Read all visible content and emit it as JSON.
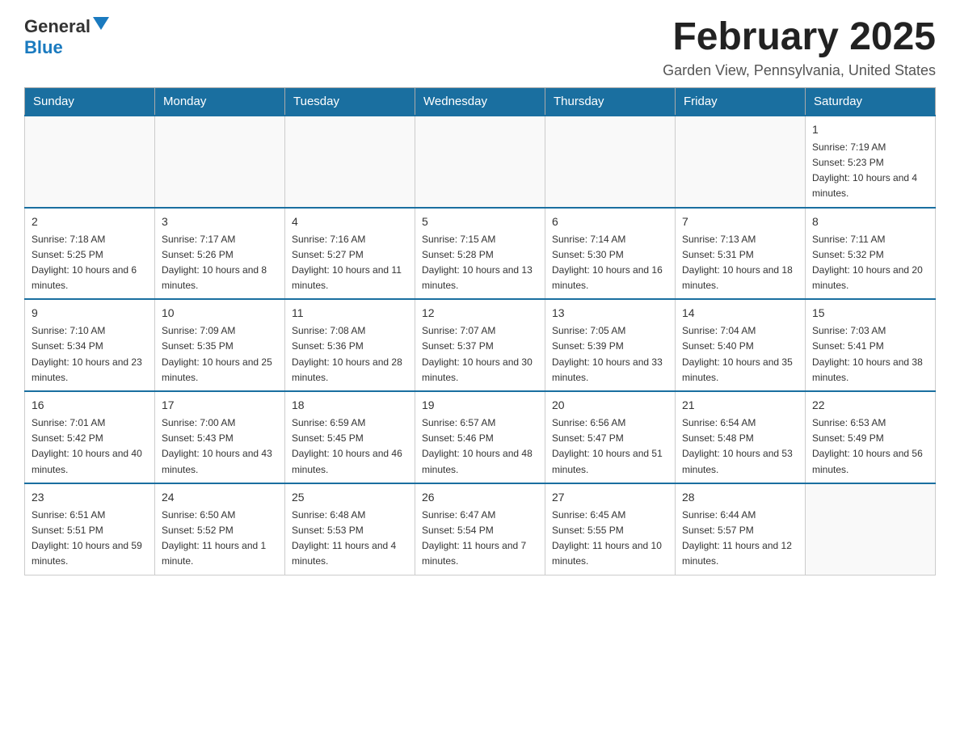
{
  "header": {
    "logo_general": "General",
    "logo_blue": "Blue",
    "month_title": "February 2025",
    "location": "Garden View, Pennsylvania, United States"
  },
  "days_of_week": [
    "Sunday",
    "Monday",
    "Tuesday",
    "Wednesday",
    "Thursday",
    "Friday",
    "Saturday"
  ],
  "weeks": [
    [
      {
        "day": "",
        "sunrise": "",
        "sunset": "",
        "daylight": ""
      },
      {
        "day": "",
        "sunrise": "",
        "sunset": "",
        "daylight": ""
      },
      {
        "day": "",
        "sunrise": "",
        "sunset": "",
        "daylight": ""
      },
      {
        "day": "",
        "sunrise": "",
        "sunset": "",
        "daylight": ""
      },
      {
        "day": "",
        "sunrise": "",
        "sunset": "",
        "daylight": ""
      },
      {
        "day": "",
        "sunrise": "",
        "sunset": "",
        "daylight": ""
      },
      {
        "day": "1",
        "sunrise": "Sunrise: 7:19 AM",
        "sunset": "Sunset: 5:23 PM",
        "daylight": "Daylight: 10 hours and 4 minutes."
      }
    ],
    [
      {
        "day": "2",
        "sunrise": "Sunrise: 7:18 AM",
        "sunset": "Sunset: 5:25 PM",
        "daylight": "Daylight: 10 hours and 6 minutes."
      },
      {
        "day": "3",
        "sunrise": "Sunrise: 7:17 AM",
        "sunset": "Sunset: 5:26 PM",
        "daylight": "Daylight: 10 hours and 8 minutes."
      },
      {
        "day": "4",
        "sunrise": "Sunrise: 7:16 AM",
        "sunset": "Sunset: 5:27 PM",
        "daylight": "Daylight: 10 hours and 11 minutes."
      },
      {
        "day": "5",
        "sunrise": "Sunrise: 7:15 AM",
        "sunset": "Sunset: 5:28 PM",
        "daylight": "Daylight: 10 hours and 13 minutes."
      },
      {
        "day": "6",
        "sunrise": "Sunrise: 7:14 AM",
        "sunset": "Sunset: 5:30 PM",
        "daylight": "Daylight: 10 hours and 16 minutes."
      },
      {
        "day": "7",
        "sunrise": "Sunrise: 7:13 AM",
        "sunset": "Sunset: 5:31 PM",
        "daylight": "Daylight: 10 hours and 18 minutes."
      },
      {
        "day": "8",
        "sunrise": "Sunrise: 7:11 AM",
        "sunset": "Sunset: 5:32 PM",
        "daylight": "Daylight: 10 hours and 20 minutes."
      }
    ],
    [
      {
        "day": "9",
        "sunrise": "Sunrise: 7:10 AM",
        "sunset": "Sunset: 5:34 PM",
        "daylight": "Daylight: 10 hours and 23 minutes."
      },
      {
        "day": "10",
        "sunrise": "Sunrise: 7:09 AM",
        "sunset": "Sunset: 5:35 PM",
        "daylight": "Daylight: 10 hours and 25 minutes."
      },
      {
        "day": "11",
        "sunrise": "Sunrise: 7:08 AM",
        "sunset": "Sunset: 5:36 PM",
        "daylight": "Daylight: 10 hours and 28 minutes."
      },
      {
        "day": "12",
        "sunrise": "Sunrise: 7:07 AM",
        "sunset": "Sunset: 5:37 PM",
        "daylight": "Daylight: 10 hours and 30 minutes."
      },
      {
        "day": "13",
        "sunrise": "Sunrise: 7:05 AM",
        "sunset": "Sunset: 5:39 PM",
        "daylight": "Daylight: 10 hours and 33 minutes."
      },
      {
        "day": "14",
        "sunrise": "Sunrise: 7:04 AM",
        "sunset": "Sunset: 5:40 PM",
        "daylight": "Daylight: 10 hours and 35 minutes."
      },
      {
        "day": "15",
        "sunrise": "Sunrise: 7:03 AM",
        "sunset": "Sunset: 5:41 PM",
        "daylight": "Daylight: 10 hours and 38 minutes."
      }
    ],
    [
      {
        "day": "16",
        "sunrise": "Sunrise: 7:01 AM",
        "sunset": "Sunset: 5:42 PM",
        "daylight": "Daylight: 10 hours and 40 minutes."
      },
      {
        "day": "17",
        "sunrise": "Sunrise: 7:00 AM",
        "sunset": "Sunset: 5:43 PM",
        "daylight": "Daylight: 10 hours and 43 minutes."
      },
      {
        "day": "18",
        "sunrise": "Sunrise: 6:59 AM",
        "sunset": "Sunset: 5:45 PM",
        "daylight": "Daylight: 10 hours and 46 minutes."
      },
      {
        "day": "19",
        "sunrise": "Sunrise: 6:57 AM",
        "sunset": "Sunset: 5:46 PM",
        "daylight": "Daylight: 10 hours and 48 minutes."
      },
      {
        "day": "20",
        "sunrise": "Sunrise: 6:56 AM",
        "sunset": "Sunset: 5:47 PM",
        "daylight": "Daylight: 10 hours and 51 minutes."
      },
      {
        "day": "21",
        "sunrise": "Sunrise: 6:54 AM",
        "sunset": "Sunset: 5:48 PM",
        "daylight": "Daylight: 10 hours and 53 minutes."
      },
      {
        "day": "22",
        "sunrise": "Sunrise: 6:53 AM",
        "sunset": "Sunset: 5:49 PM",
        "daylight": "Daylight: 10 hours and 56 minutes."
      }
    ],
    [
      {
        "day": "23",
        "sunrise": "Sunrise: 6:51 AM",
        "sunset": "Sunset: 5:51 PM",
        "daylight": "Daylight: 10 hours and 59 minutes."
      },
      {
        "day": "24",
        "sunrise": "Sunrise: 6:50 AM",
        "sunset": "Sunset: 5:52 PM",
        "daylight": "Daylight: 11 hours and 1 minute."
      },
      {
        "day": "25",
        "sunrise": "Sunrise: 6:48 AM",
        "sunset": "Sunset: 5:53 PM",
        "daylight": "Daylight: 11 hours and 4 minutes."
      },
      {
        "day": "26",
        "sunrise": "Sunrise: 6:47 AM",
        "sunset": "Sunset: 5:54 PM",
        "daylight": "Daylight: 11 hours and 7 minutes."
      },
      {
        "day": "27",
        "sunrise": "Sunrise: 6:45 AM",
        "sunset": "Sunset: 5:55 PM",
        "daylight": "Daylight: 11 hours and 10 minutes."
      },
      {
        "day": "28",
        "sunrise": "Sunrise: 6:44 AM",
        "sunset": "Sunset: 5:57 PM",
        "daylight": "Daylight: 11 hours and 12 minutes."
      },
      {
        "day": "",
        "sunrise": "",
        "sunset": "",
        "daylight": ""
      }
    ]
  ]
}
